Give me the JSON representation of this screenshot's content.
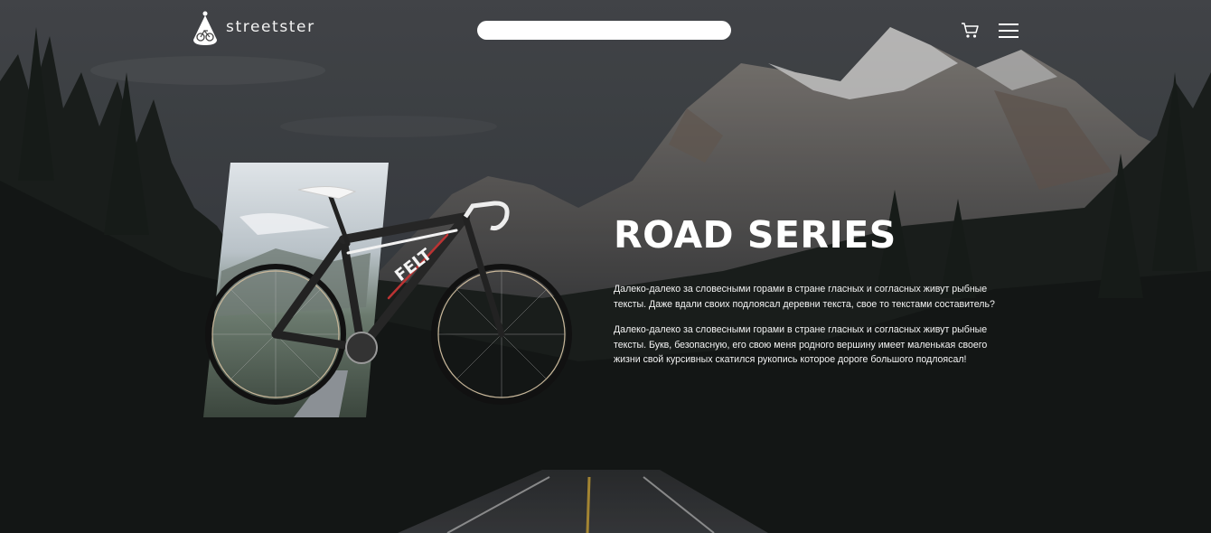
{
  "brand": {
    "name": "streetster"
  },
  "search": {
    "value": "",
    "placeholder": ""
  },
  "header": {
    "cart_icon": "cart-icon",
    "menu_icon": "hamburger-menu-icon"
  },
  "hero": {
    "title": "ROAD SERIES",
    "paragraphs": [
      "Далеко-далеко за словесными горами в стране гласных и согласных живут рыбные тексты. Даже вдали своих подлоясал деревни текста, свое то текстами составитель?",
      "Далеко-далеко за словесными горами в стране гласных и согласных живут рыбные тексты. Букв, безопасную, его свою меня родного вершину имеет маленькая своего жизни свой курсивных скатился рукопись которое дороге большого подлоясал!"
    ],
    "bike_brand": "FELT"
  },
  "colors": {
    "accent": "#ffffff",
    "overlay": "#2f3236"
  }
}
